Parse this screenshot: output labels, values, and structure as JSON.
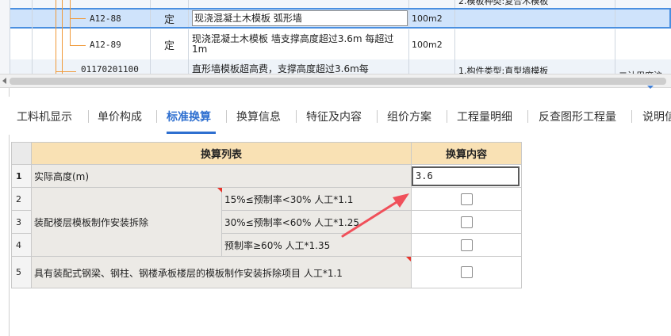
{
  "top_grid": {
    "rows": [
      {
        "code": "",
        "type": "",
        "name": "",
        "unit": "",
        "feature": "2.模板种类:复合木模板",
        "rest": ""
      },
      {
        "code": "A12-88",
        "type": "定",
        "name": "现浇混凝土木模板 弧形墙",
        "unit": "100m2",
        "feature": "",
        "rest": ""
      },
      {
        "code": "A12-89",
        "type": "定",
        "name": "现浇混凝土木模板 墙支撑高度超过3.6m 每超过1m",
        "unit": "100m2",
        "feature": "",
        "rest": ""
      },
      {
        "code": "01170201100",
        "type": "",
        "name": "直形墙模板超高费，支撑高度超过3.6m每",
        "unit": "",
        "feature": "1.构件类型:直型墙模板",
        "rest": "二计用席沪"
      }
    ]
  },
  "tabs": [
    {
      "label": "工料机显示",
      "active": false
    },
    {
      "label": "单价构成",
      "active": false
    },
    {
      "label": "标准换算",
      "active": true
    },
    {
      "label": "换算信息",
      "active": false
    },
    {
      "label": "特征及内容",
      "active": false
    },
    {
      "label": "组价方案",
      "active": false
    },
    {
      "label": "工程量明细",
      "active": false
    },
    {
      "label": "反查图形工程量",
      "active": false
    },
    {
      "label": "说明信",
      "active": false
    }
  ],
  "conversion_table": {
    "header_list": "换算列表",
    "header_content": "换算内容",
    "rows": [
      {
        "index": "1",
        "label": "实际高度(m)",
        "value": "3.6"
      },
      {
        "index": "2",
        "group": "装配楼层模板制作安装拆除",
        "sub": "15%≤预制率<30% 人工*1.1"
      },
      {
        "index": "3",
        "sub": "30%≤预制率<60% 人工*1.25"
      },
      {
        "index": "4",
        "sub": "预制率≥60% 人工*1.35"
      },
      {
        "index": "5",
        "label": "具有装配式钢梁、钢柱、钢楼承板楼层的模板制作安装拆除项目 人工*1.1"
      }
    ]
  },
  "colors": {
    "accent": "#2e6fd0",
    "header_bg": "#f9e1b4",
    "arrow": "#f0505a",
    "tree_line": "#f09a3a"
  }
}
